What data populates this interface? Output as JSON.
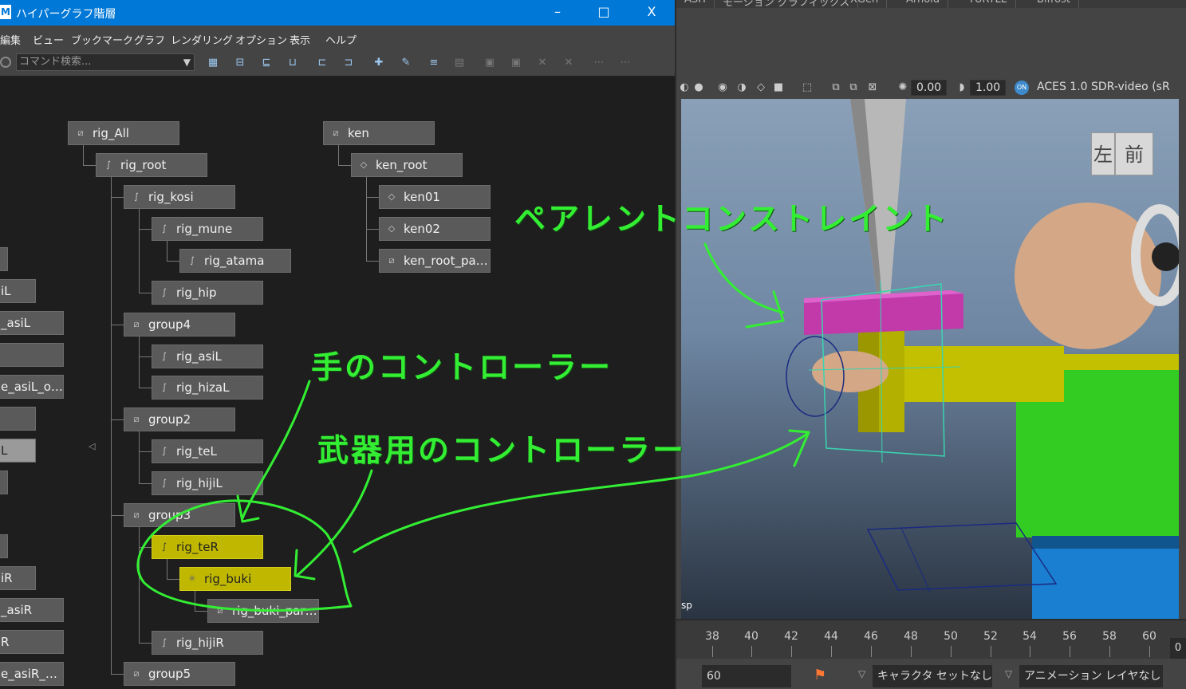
{
  "window": {
    "logo": "M",
    "title": "ハイパーグラフ階層",
    "minimize": "–",
    "maximize": "□",
    "close": "X"
  },
  "menu": [
    "編集",
    "ビュー",
    "ブックマーク",
    "グラフ",
    "レンダリング",
    "オプション",
    "表示",
    "ヘルプ"
  ],
  "toolbar": {
    "search_placeholder": "コマンド検索...",
    "dropdown": "▼"
  },
  "graph": {
    "collapse_arrow": "◁",
    "nodes": {
      "rig_all": "rig_All",
      "rig_root": "rig_root",
      "rig_kosi": "rig_kosi",
      "rig_mune": "rig_mune",
      "rig_atama": "rig_atama",
      "rig_hip": "rig_hip",
      "group4": "group4",
      "rig_asil": "rig_asiL",
      "rig_hizal": "rig_hizaL",
      "group2": "group2",
      "rig_tel": "rig_teL",
      "rig_hijil": "rig_hijiL",
      "group3": "group3",
      "rig_ter": "rig_teR",
      "rig_buki": "rig_buki",
      "rig_buki_par": "rig_buki_par…",
      "rig_hijir": "rig_hijiR",
      "group5": "group5",
      "ken": "ken",
      "ken_root": "ken_root",
      "ken01": "ken01",
      "ken02": "ken02",
      "ken_root_pa": "ken_root_pa…"
    },
    "left_partial": {
      "p1": "iL",
      "p2": "_asiL",
      "p3": "e_asiL_o…",
      "p4": "L",
      "p5": "iR",
      "p6": "_asiR",
      "p7": "R",
      "p8": "e_asiR_…"
    }
  },
  "maya": {
    "shelf_tabs": [
      "ASH",
      "モーション グラフィックス",
      "XGen",
      "Arnold",
      "TURTLE",
      "Bifrost"
    ],
    "exposure": "0.00",
    "gamma": "1.00",
    "on_badge": "ON",
    "color_space": "ACES 1.0 SDR-video (sR",
    "viewcube_left": "左",
    "viewcube_front": "前",
    "camera_label": "sp",
    "timeline_ticks": [
      "38",
      "40",
      "42",
      "44",
      "46",
      "48",
      "50",
      "52",
      "54",
      "56",
      "58",
      "60"
    ],
    "current_frame": "0",
    "end_frame": "60",
    "character_set": "キャラクタ セットなし",
    "anim_layer": "アニメーション レイヤなし"
  },
  "annotations": {
    "parent_constraint": "ペアレントコンストレイント",
    "hand_controller": "手のコントローラー",
    "weapon_controller": "武器用のコントローラー"
  },
  "colors": {
    "title_bar": "#0078d7",
    "selected_node": "#c0b800",
    "annotation": "#33ee33"
  }
}
